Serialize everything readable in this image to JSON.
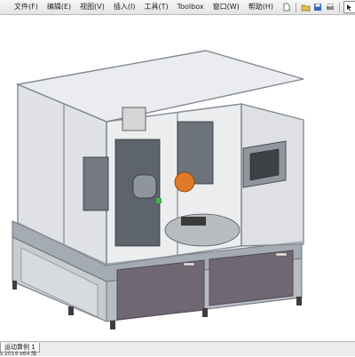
{
  "menubar": {
    "items": [
      "文件(F)",
      "编辑(E)",
      "视图(V)",
      "插入(I)",
      "工具(T)",
      "Toolbox",
      "窗口(W)",
      "帮助(H)"
    ]
  },
  "toolbar": {
    "icons": [
      "new-document-icon",
      "open-folder-icon",
      "save-icon",
      "print-icon",
      "arrow-pointer-icon"
    ]
  },
  "statusbar": {
    "motion_tab": "运动算例 1",
    "version_text": "s 2014 x64 版"
  },
  "colors": {
    "frame": "#8f97a1",
    "glass": "#c9cdd3",
    "panel": "#6d6670",
    "machine": "#5c636a",
    "accent_orange": "#e07a2a",
    "accent_green": "#3bb24a"
  }
}
